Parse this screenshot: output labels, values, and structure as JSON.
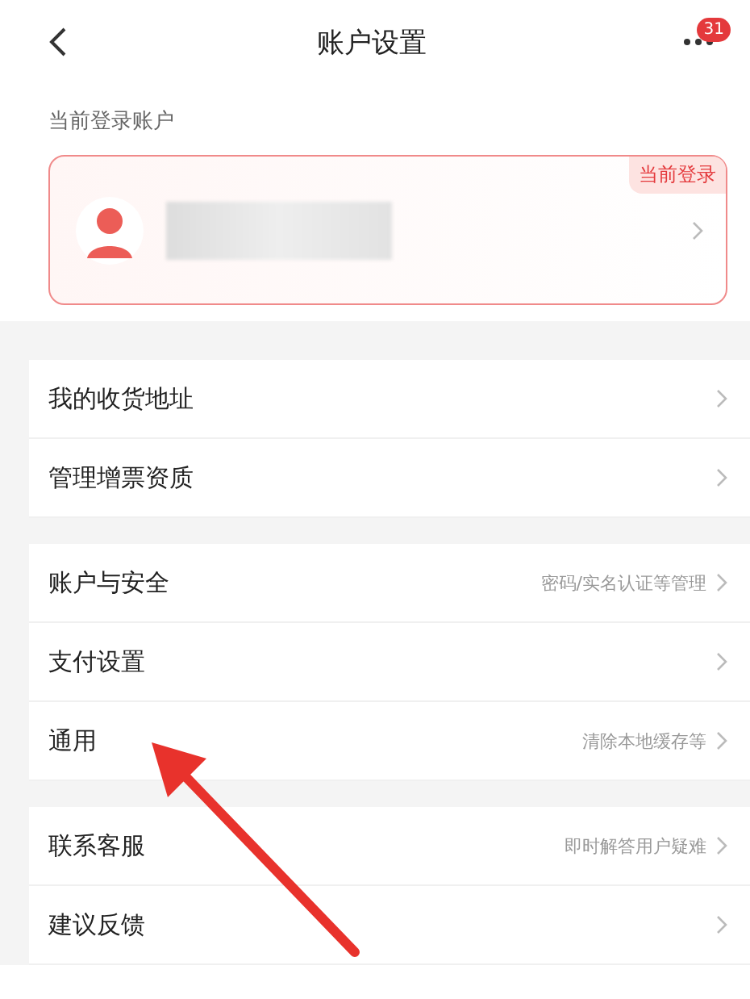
{
  "header": {
    "title": "账户设置",
    "badge": "31"
  },
  "section_label": "当前登录账户",
  "account_card": {
    "tag": "当前登录"
  },
  "groups": [
    {
      "items": [
        {
          "label": "我的收货地址"
        },
        {
          "label": "管理增票资质"
        }
      ]
    },
    {
      "items": [
        {
          "label": "账户与安全",
          "hint": "密码/实名认证等管理"
        },
        {
          "label": "支付设置"
        },
        {
          "label": "通用",
          "hint": "清除本地缓存等"
        }
      ]
    },
    {
      "items": [
        {
          "label": "联系客服",
          "hint": "即时解答用户疑难"
        },
        {
          "label": "建议反馈"
        }
      ]
    }
  ]
}
